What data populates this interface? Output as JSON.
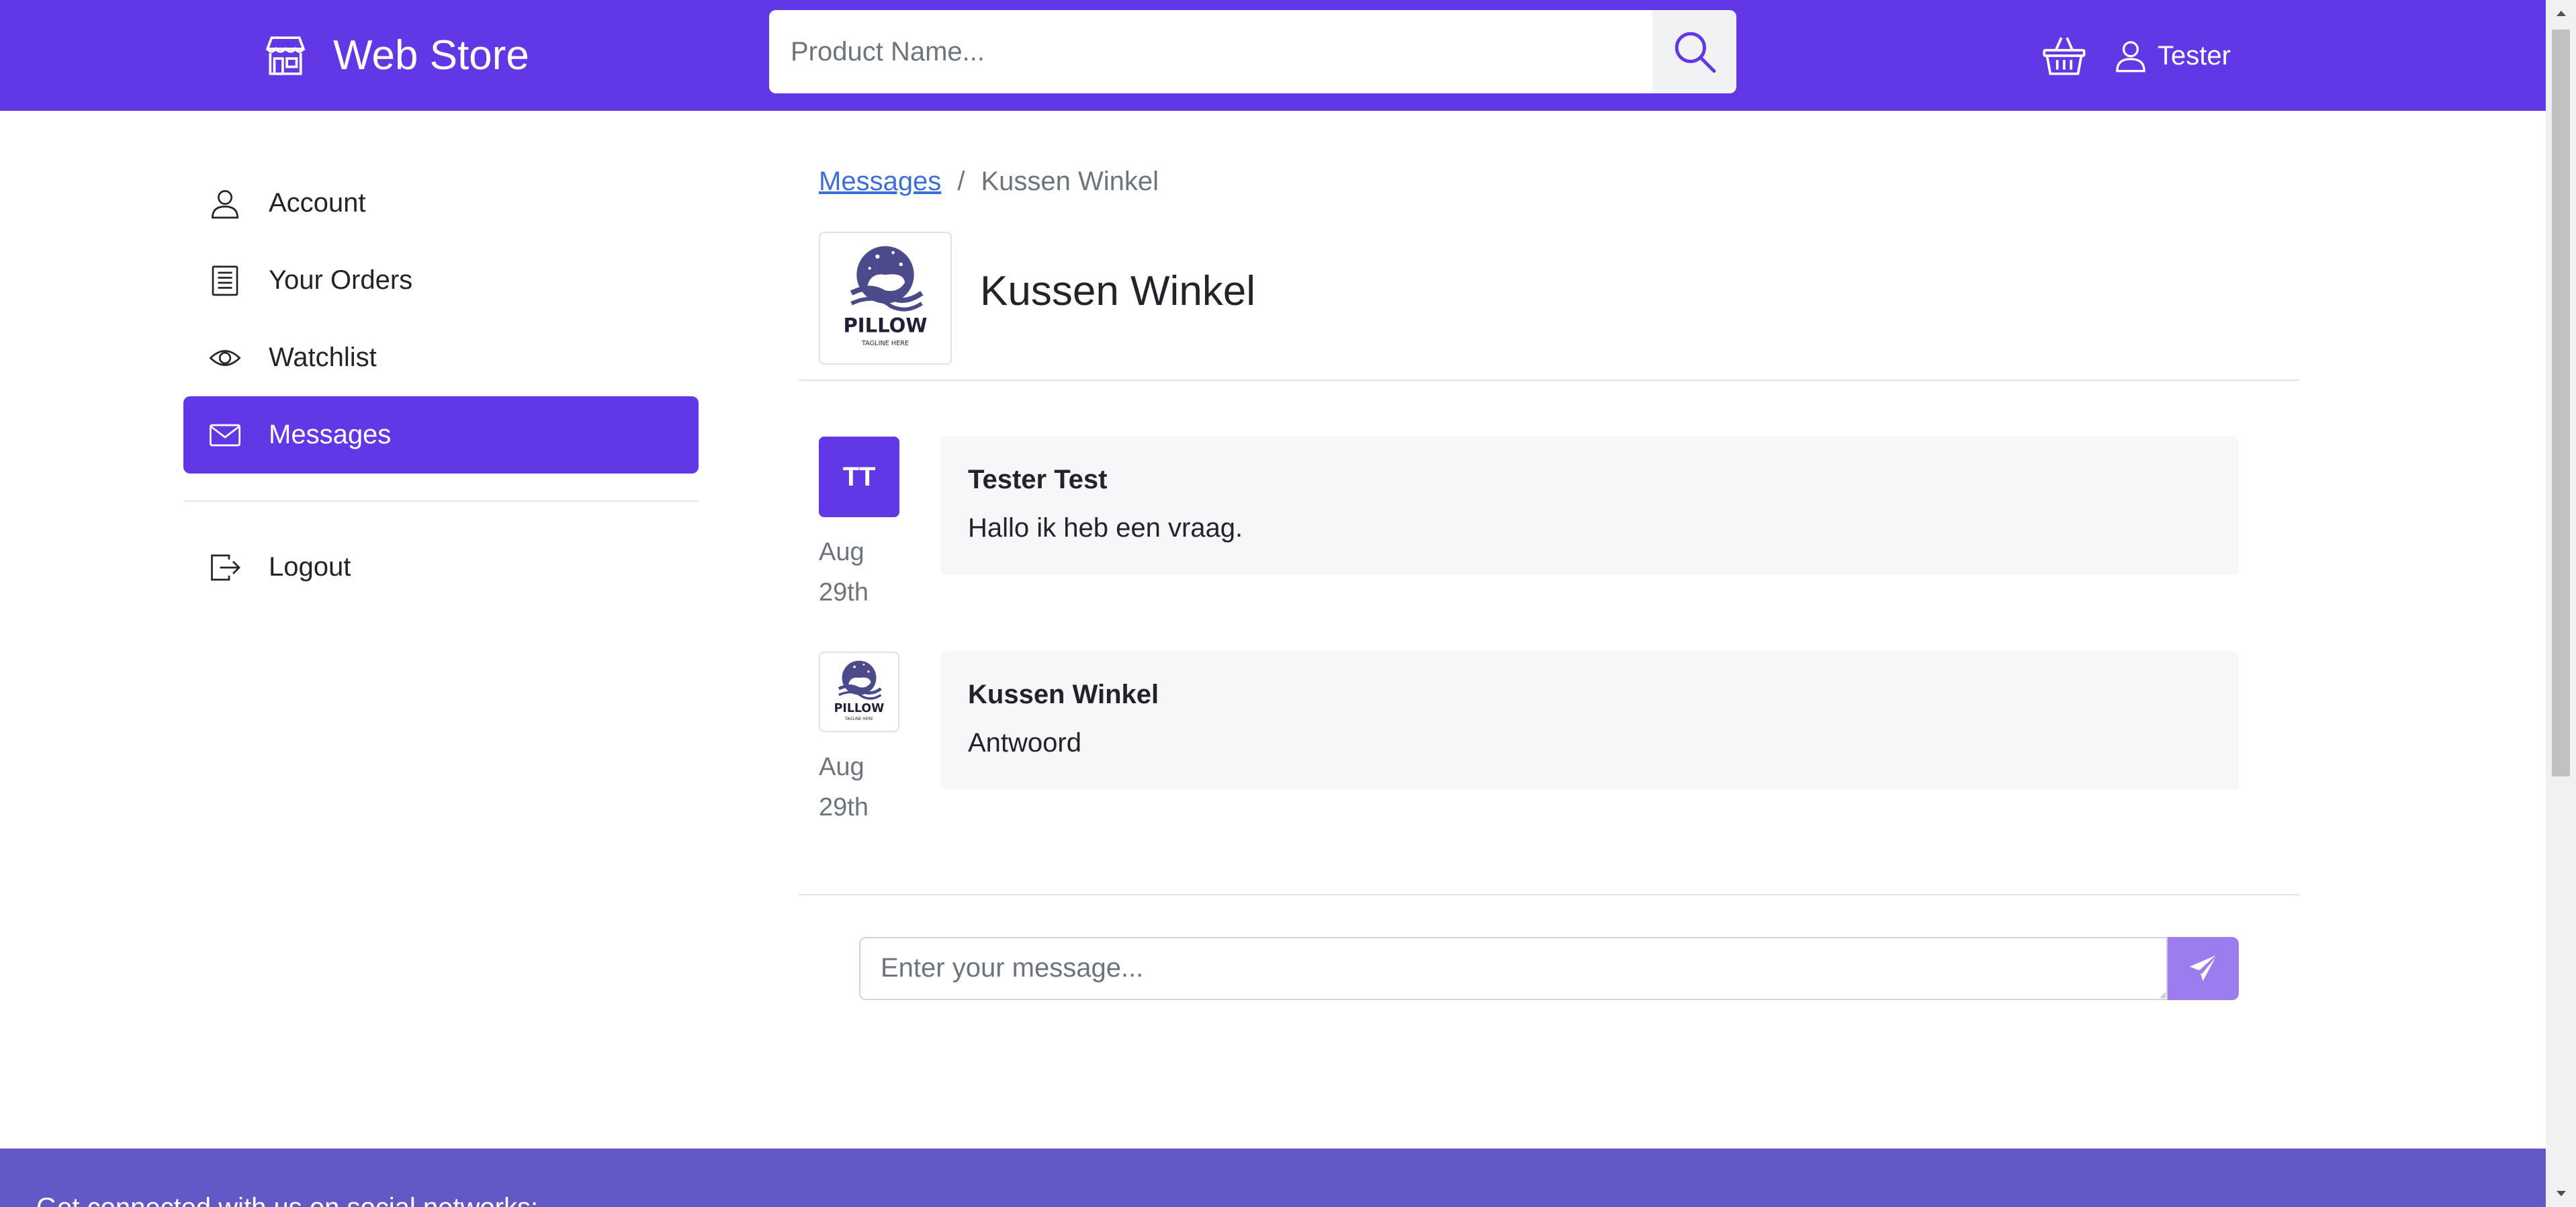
{
  "header": {
    "brand": "Web Store",
    "search_placeholder": "Product Name...",
    "user_name": "Tester"
  },
  "sidebar": {
    "items": [
      {
        "label": "Account",
        "icon": "person-icon"
      },
      {
        "label": "Your Orders",
        "icon": "receipt-icon"
      },
      {
        "label": "Watchlist",
        "icon": "eye-icon"
      },
      {
        "label": "Messages",
        "icon": "envelope-icon",
        "active": true
      },
      {
        "label": "Logout",
        "icon": "logout-icon"
      }
    ]
  },
  "conversation": {
    "breadcrumb": {
      "parent": "Messages",
      "separator": "/",
      "current": "Kussen Winkel"
    },
    "shop_name": "Kussen Winkel",
    "logo_text": "PILLOW",
    "logo_tagline": "TAGLINE HERE",
    "messages": [
      {
        "avatar": "TT",
        "date_month": "Aug",
        "date_day": "29th",
        "sender": "Tester Test",
        "text": "Hallo ik heb een vraag."
      },
      {
        "avatar": "pillow-logo",
        "date_month": "Aug",
        "date_day": "29th",
        "sender": "Kussen Winkel",
        "text": "Antwoord"
      }
    ],
    "composer_placeholder": "Enter your message..."
  },
  "footer": {
    "text": "Get connected with us on social networks:"
  },
  "colors": {
    "primary": "#6237e6",
    "footer": "#6359c6",
    "send_button": "#9d7cf0",
    "link": "#3b6fd7",
    "bubble": "#f7f7f9"
  }
}
